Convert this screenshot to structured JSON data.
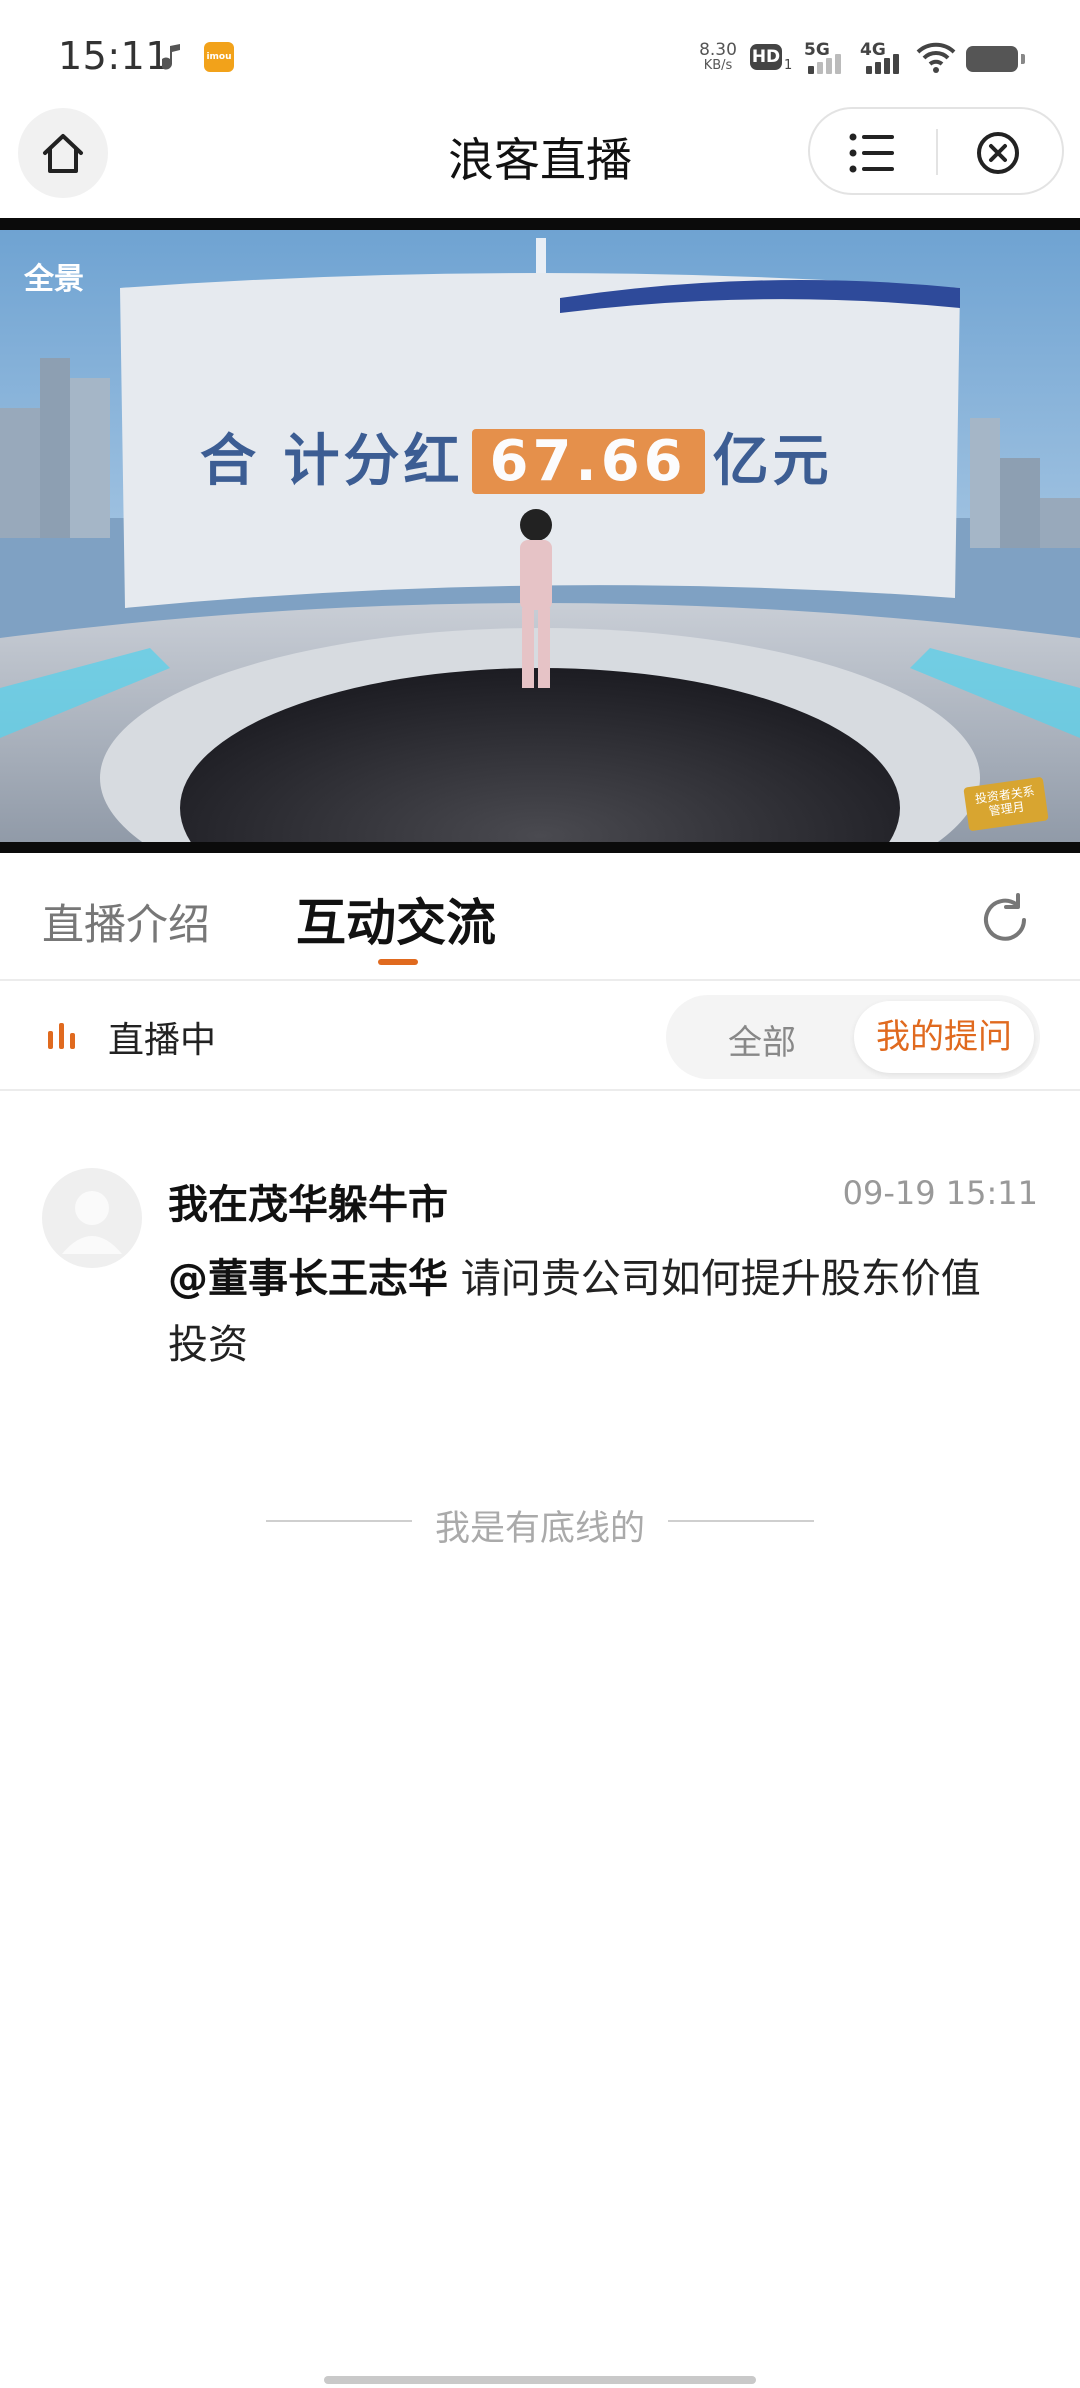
{
  "status_bar": {
    "time": "15:11",
    "app_icon_label": "imou",
    "net_speed_value": "8.30",
    "net_speed_unit": "KB/s",
    "hd_label": "HD",
    "hd_sub": "1",
    "net1": "5G",
    "net2": "4G",
    "icons": [
      "music-note-icon",
      "hd-icon",
      "signal-5g-icon",
      "signal-4g-icon",
      "wifi-icon",
      "battery-icon"
    ]
  },
  "header": {
    "title": "浪客直播",
    "icons": [
      "home-icon",
      "menu-list-icon",
      "close-circle-icon"
    ]
  },
  "video": {
    "logo_text": "全景",
    "headline_prefix": "合 计分红",
    "headline_number": "67.66",
    "headline_suffix": "亿元",
    "badge_line1": "投资者关系",
    "badge_line2": "管理月"
  },
  "tabs": [
    {
      "label": "直播介绍",
      "active": false
    },
    {
      "label": "互动交流",
      "active": true
    }
  ],
  "live": {
    "status": "直播中",
    "filters": [
      {
        "label": "全部",
        "selected": false
      },
      {
        "label": "我的提问",
        "selected": true
      }
    ]
  },
  "messages": [
    {
      "user": "我在茂华躲牛市",
      "time": "09-19 15:11",
      "mention": "@董事长王志华",
      "text": " 请问贵公司如何提升股东价值投资"
    }
  ],
  "footer": {
    "end_text": "我是有底线的"
  },
  "colors": {
    "accent": "#e06a1f",
    "text_primary": "#111111",
    "text_muted": "#999999",
    "divider": "#ececec"
  }
}
